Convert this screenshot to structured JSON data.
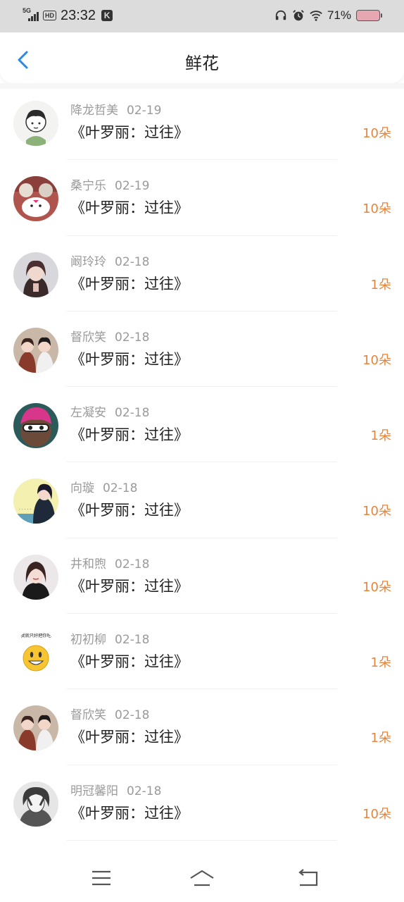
{
  "status_bar": {
    "network": "5G",
    "hd": "HD",
    "time": "23:32",
    "app_icon_letter": "K",
    "battery_percent": "71%",
    "icons": [
      "headphones-icon",
      "alarm-icon",
      "wifi-icon",
      "battery-icon"
    ]
  },
  "header": {
    "title": "鲜花",
    "back_icon": "chevron-left-icon",
    "accent_color": "#2a8ae0"
  },
  "list": {
    "count_color": "#e8843a",
    "items": [
      {
        "user": "降龙哲美",
        "date": "02-19",
        "work": "《叶罗丽：过往》",
        "count": "10朵"
      },
      {
        "user": "桑宁乐",
        "date": "02-19",
        "work": "《叶罗丽：过往》",
        "count": "10朵"
      },
      {
        "user": "阚玲玲",
        "date": "02-18",
        "work": "《叶罗丽：过往》",
        "count": "1朵"
      },
      {
        "user": "督欣笑",
        "date": "02-18",
        "work": "《叶罗丽：过往》",
        "count": "10朵"
      },
      {
        "user": "左凝安",
        "date": "02-18",
        "work": "《叶罗丽：过往》",
        "count": "1朵"
      },
      {
        "user": "向璇",
        "date": "02-18",
        "work": "《叶罗丽：过往》",
        "count": "10朵"
      },
      {
        "user": "井和煦",
        "date": "02-18",
        "work": "《叶罗丽：过往》",
        "count": "10朵"
      },
      {
        "user": "初初柳",
        "date": "02-18",
        "work": "《叶罗丽：过往》",
        "count": "1朵"
      },
      {
        "user": "督欣笑",
        "date": "02-18",
        "work": "《叶罗丽：过往》",
        "count": "1朵"
      },
      {
        "user": "明冠馨阳",
        "date": "02-18",
        "work": "《叶罗丽：过往》",
        "count": "10朵"
      }
    ],
    "avatar_8_caption": "我就只好把你吃"
  },
  "navbar": {
    "icons": [
      "menu-icon",
      "home-icon",
      "back-icon"
    ]
  }
}
